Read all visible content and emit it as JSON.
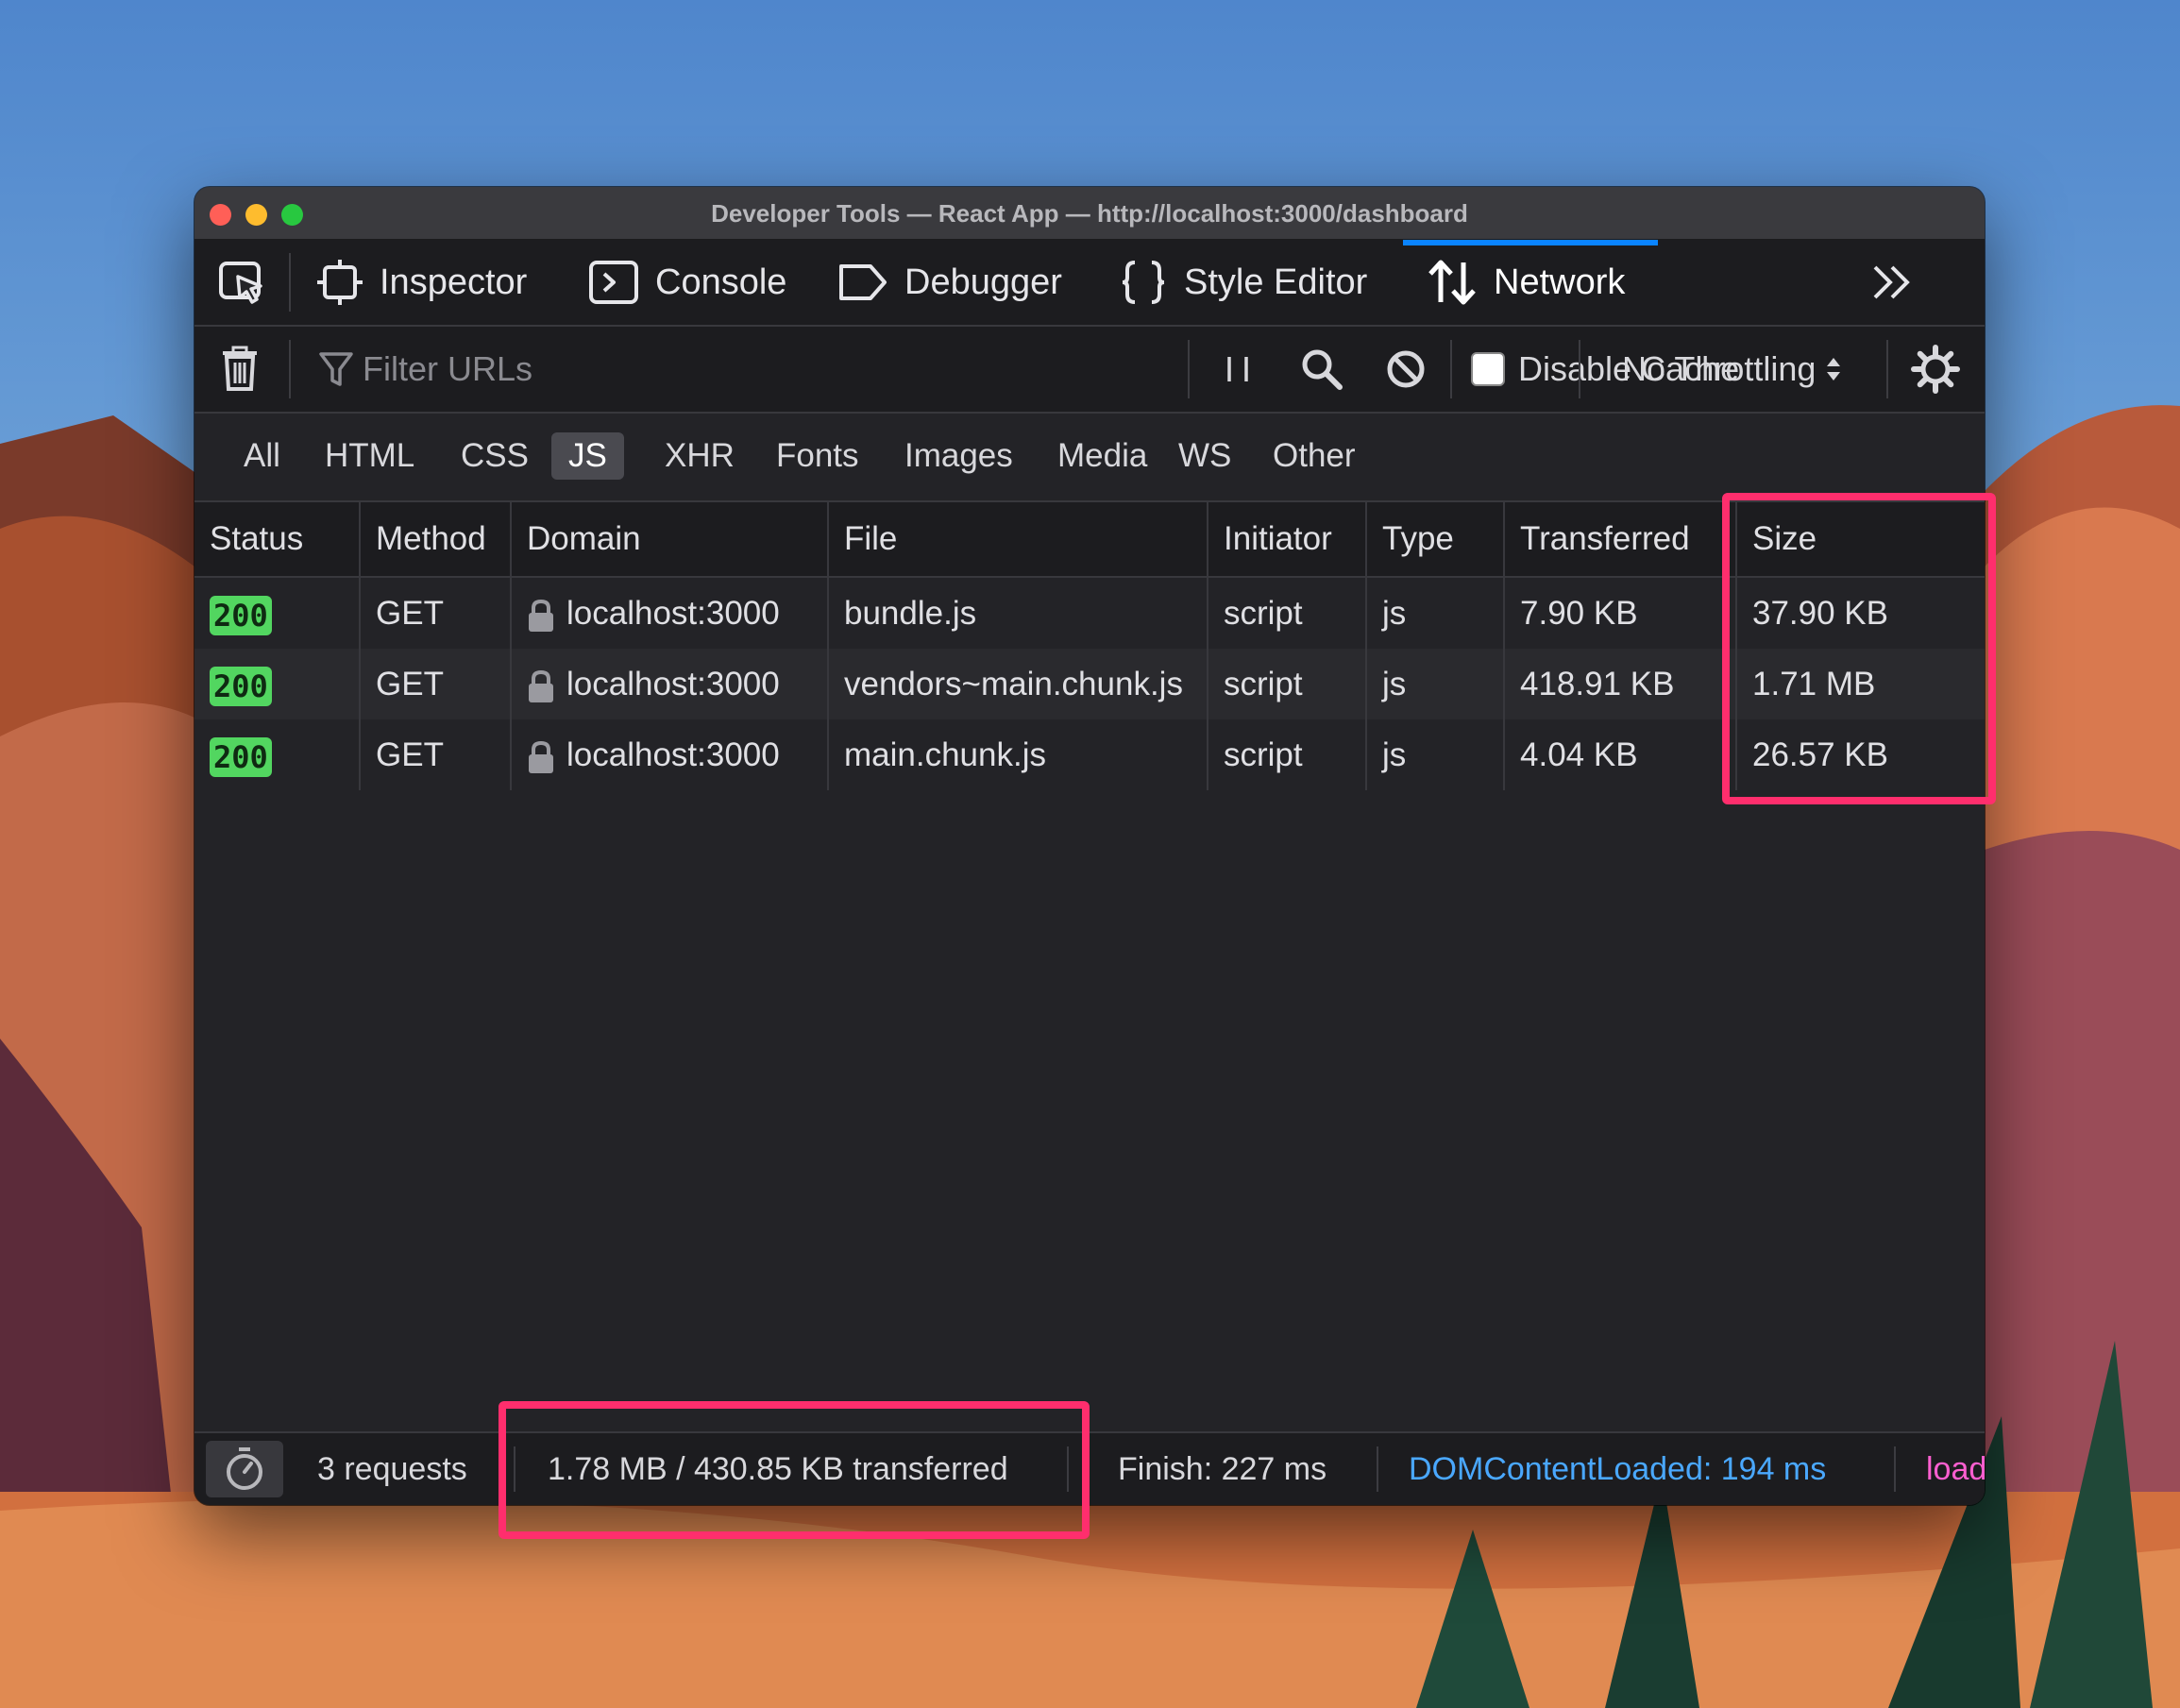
{
  "window": {
    "title": "Developer Tools — React App — http://localhost:3000/dashboard"
  },
  "toolbar": {
    "tabs": [
      {
        "label": "Inspector",
        "icon": "inspector-icon"
      },
      {
        "label": "Console",
        "icon": "console-icon"
      },
      {
        "label": "Debugger",
        "icon": "debugger-icon"
      },
      {
        "label": "Style Editor",
        "icon": "style-editor-icon"
      },
      {
        "label": "Network",
        "icon": "network-icon",
        "active": true
      }
    ],
    "active_color": "#0a84ff"
  },
  "filterbar": {
    "filter_placeholder": "Filter URLs",
    "disable_cache_label": "Disable Cache",
    "disable_cache_checked": false,
    "throttling_value": "No Throttling"
  },
  "type_filters": {
    "items": [
      "All",
      "HTML",
      "CSS",
      "JS",
      "XHR",
      "Fonts",
      "Images",
      "Media",
      "WS",
      "Other"
    ],
    "active": "JS"
  },
  "table": {
    "columns": [
      "Status",
      "Method",
      "Domain",
      "File",
      "Initiator",
      "Type",
      "Transferred",
      "Size"
    ],
    "rows": [
      {
        "status": "200",
        "method": "GET",
        "domain": "localhost:3000",
        "file": "bundle.js",
        "initiator": "script",
        "type": "js",
        "transferred": "7.90 KB",
        "size": "37.90 KB"
      },
      {
        "status": "200",
        "method": "GET",
        "domain": "localhost:3000",
        "file": "vendors~main.chunk.js",
        "initiator": "script",
        "type": "js",
        "transferred": "418.91 KB",
        "size": "1.71 MB"
      },
      {
        "status": "200",
        "method": "GET",
        "domain": "localhost:3000",
        "file": "main.chunk.js",
        "initiator": "script",
        "type": "js",
        "transferred": "4.04 KB",
        "size": "26.57 KB"
      }
    ]
  },
  "statusbar": {
    "requests": "3 requests",
    "transferred": "1.78 MB / 430.85 KB transferred",
    "finish": "Finish: 227 ms",
    "dom_content_loaded": "DOMContentLoaded: 194 ms",
    "load": "load",
    "dcl_color": "#4aa8ff",
    "load_color": "#ff5fd0"
  },
  "highlight_color": "#ff2e6d"
}
